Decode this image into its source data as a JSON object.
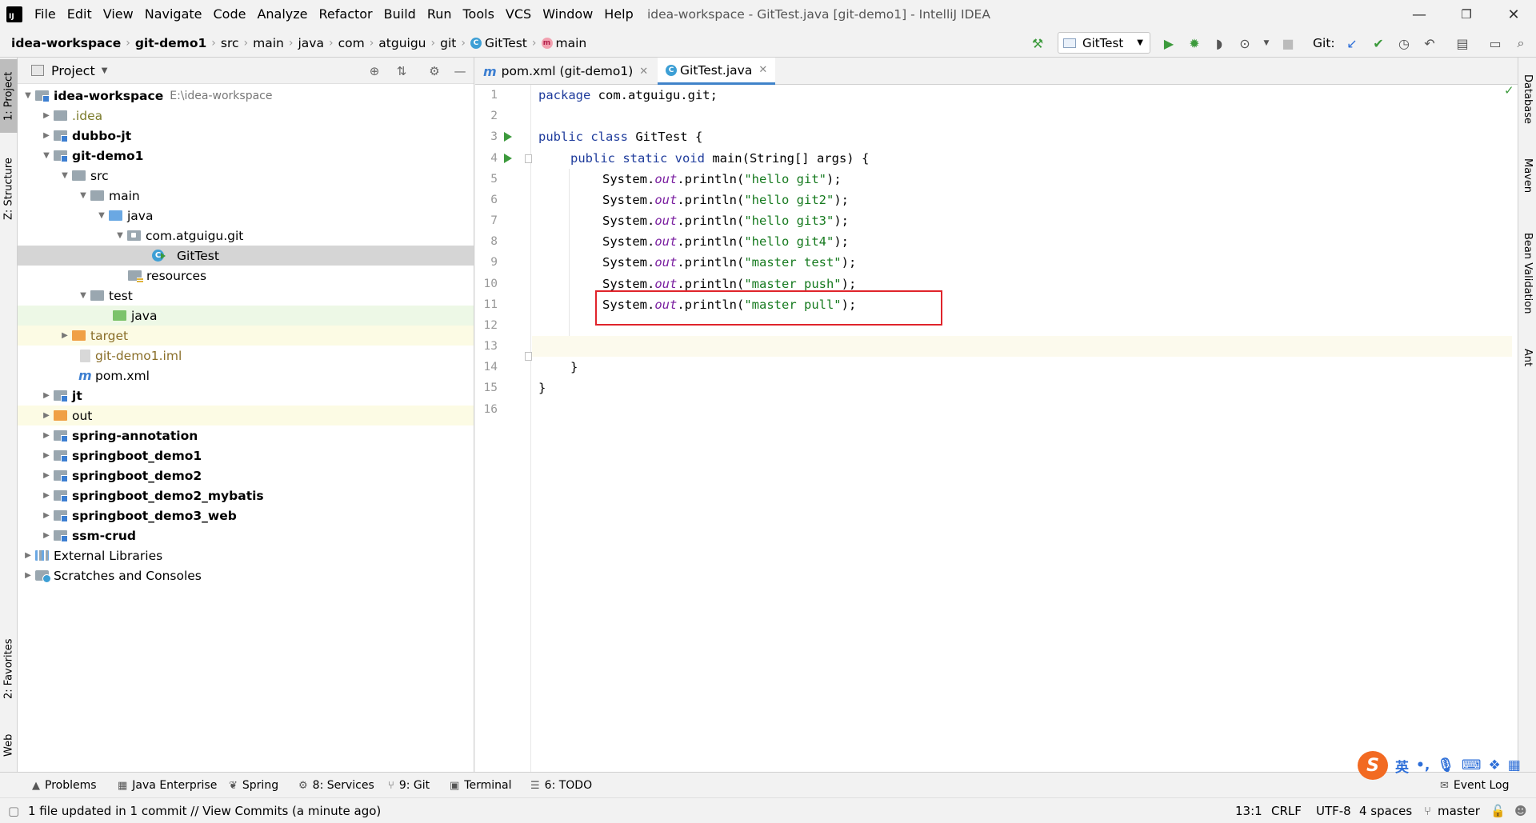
{
  "window": {
    "title": "idea-workspace - GitTest.java [git-demo1] - IntelliJ IDEA",
    "logo_text": "IJ",
    "minimize": "—",
    "restore": "❐",
    "close": "✕"
  },
  "menu": [
    "File",
    "Edit",
    "View",
    "Navigate",
    "Code",
    "Analyze",
    "Refactor",
    "Build",
    "Run",
    "Tools",
    "VCS",
    "Window",
    "Help"
  ],
  "breadcrumb": [
    "idea-workspace",
    "git-demo1",
    "src",
    "main",
    "java",
    "com",
    "atguigu",
    "git",
    "GitTest",
    "main"
  ],
  "toolbar": {
    "run_config": "GitTest",
    "git_label": "Git:"
  },
  "project": {
    "title": "Project",
    "tree": [
      {
        "label": "idea-workspace",
        "path": "E:\\idea-workspace",
        "icon": "module-folder"
      },
      {
        "label": ".idea",
        "icon": "folder"
      },
      {
        "label": "dubbo-jt",
        "icon": "module-folder"
      },
      {
        "label": "git-demo1",
        "icon": "module-folder"
      },
      {
        "label": "src",
        "icon": "folder"
      },
      {
        "label": "main",
        "icon": "folder"
      },
      {
        "label": "java",
        "icon": "source-folder"
      },
      {
        "label": "com.atguigu.git",
        "icon": "package"
      },
      {
        "label": "GitTest",
        "icon": "java-class"
      },
      {
        "label": "resources",
        "icon": "resources-folder"
      },
      {
        "label": "test",
        "icon": "folder"
      },
      {
        "label": "java",
        "icon": "test-folder"
      },
      {
        "label": "target",
        "icon": "excluded-folder"
      },
      {
        "label": "git-demo1.iml",
        "icon": "iml-file"
      },
      {
        "label": "pom.xml",
        "icon": "maven-file"
      },
      {
        "label": "jt",
        "icon": "module-folder"
      },
      {
        "label": "out",
        "icon": "excluded-folder"
      },
      {
        "label": "spring-annotation",
        "icon": "module-folder"
      },
      {
        "label": "springboot_demo1",
        "icon": "module-folder"
      },
      {
        "label": "springboot_demo2",
        "icon": "module-folder"
      },
      {
        "label": "springboot_demo2_mybatis",
        "icon": "module-folder"
      },
      {
        "label": "springboot_demo3_web",
        "icon": "module-folder"
      },
      {
        "label": "ssm-crud",
        "icon": "module-folder"
      },
      {
        "label": "External Libraries",
        "icon": "libraries"
      },
      {
        "label": "Scratches and Consoles",
        "icon": "scratches"
      }
    ]
  },
  "left_tabs": [
    "1: Project",
    "Z: Structure",
    "2: Favorites",
    "Web"
  ],
  "right_tabs": [
    "Database",
    "Maven",
    "Bean Validation",
    "Ant"
  ],
  "editor": {
    "tabs": [
      {
        "label": "pom.xml (git-demo1)",
        "active": false
      },
      {
        "label": "GitTest.java",
        "active": true
      }
    ],
    "line_numbers": [
      "1",
      "2",
      "3",
      "4",
      "5",
      "6",
      "7",
      "8",
      "9",
      "10",
      "11",
      "12",
      "13",
      "14",
      "15",
      "16"
    ],
    "code": {
      "l1_kw": "package",
      "l1_rest": " com.atguigu.git;",
      "l3_kw": "public class",
      "l3_rest": " GitTest {",
      "l4_kw": "public static void",
      "l4_rest": " main(String[] args) {",
      "sys": "System.",
      "out": "out",
      "println": ".println(",
      "end": ");",
      "s5": "\"hello git\"",
      "s6": "\"hello git2\"",
      "s7": "\"hello git3\"",
      "s8": "\"hello git4\"",
      "s9": "\"master test\"",
      "s10": "\"master push\"",
      "s11": "\"master pull\"",
      "l14": "}",
      "l15": "}"
    }
  },
  "bottom_tabs": [
    {
      "label": "Problems",
      "icon": "problems-icon"
    },
    {
      "label": "Java Enterprise",
      "icon": "java-enterprise-icon"
    },
    {
      "label": "Spring",
      "icon": "spring-icon"
    },
    {
      "label": "8: Services",
      "icon": "services-icon"
    },
    {
      "label": "9: Git",
      "icon": "git-icon"
    },
    {
      "label": "Terminal",
      "icon": "terminal-icon"
    },
    {
      "label": "6: TODO",
      "icon": "todo-icon"
    },
    {
      "label": "Event Log",
      "icon": "event-log-icon"
    }
  ],
  "status": {
    "message": "1 file updated in 1 commit // View Commits (a minute ago)",
    "position": "13:1",
    "line_sep": "CRLF",
    "encoding": "UTF-8",
    "indent": "4 spaces",
    "branch": "master"
  },
  "ime": {
    "logo": "S",
    "lang": "英"
  },
  "colors": {
    "accent": "#4083c9",
    "highlight_box": "#e0242b",
    "run_green": "#3c9a3c"
  }
}
